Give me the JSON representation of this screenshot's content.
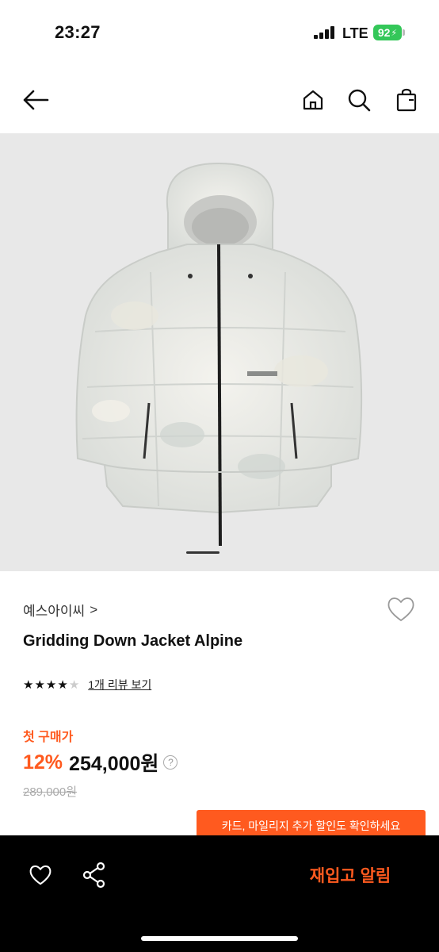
{
  "status_bar": {
    "time": "23:27",
    "network": "LTE",
    "battery": "92"
  },
  "nav": {
    "back_icon": "arrow-left-icon",
    "home_icon": "home-icon",
    "search_icon": "search-icon",
    "cart_icon": "shopping-bag-icon"
  },
  "product": {
    "brand": "예스아이씨",
    "brand_chevron": ">",
    "name": "Gridding Down Jacket Alpine",
    "rating_stars": 4,
    "rating_max": 5,
    "review_link": "1개 리뷰 보기",
    "first_price_label": "첫 구매가",
    "discount": "12%",
    "price": "254,000원",
    "price_help": "?",
    "original_price": "289,000원",
    "image_count_indicator": "1"
  },
  "promo": {
    "text": "카드, 마일리지 추가 할인도 확인하세요"
  },
  "bottom_bar": {
    "wish_icon": "heart-icon",
    "share_icon": "share-icon",
    "restock_label": "재입고 알림"
  },
  "colors": {
    "accent": "#ff5a1f",
    "battery": "#34c759",
    "image_bg": "#e8e8e8"
  }
}
